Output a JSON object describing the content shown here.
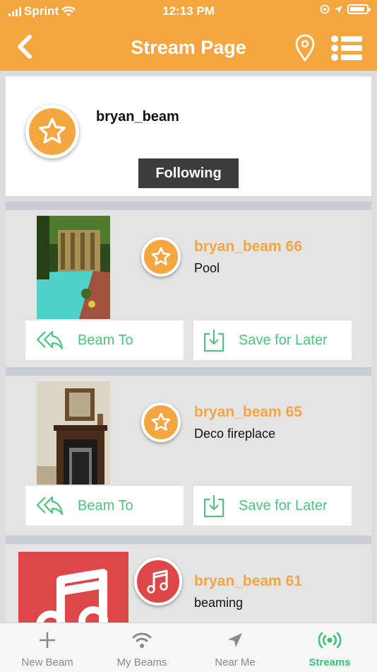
{
  "status_bar": {
    "carrier": "Sprint",
    "time": "12:13 PM"
  },
  "header": {
    "title": "Stream Page",
    "back_icon": "chevron-left-icon",
    "location_icon": "map-pin-icon",
    "menu_icon": "list-icon"
  },
  "profile": {
    "username": "bryan_beam",
    "follow_label": "Following",
    "avatar_icon": "star-icon"
  },
  "posts": [
    {
      "user": "bryan_beam 66",
      "caption": "Pool",
      "avatar_icon": "star-icon",
      "beam_to_label": "Beam To",
      "save_label": "Save for Later"
    },
    {
      "user": "bryan_beam 65",
      "caption": "Deco fireplace",
      "avatar_icon": "star-icon",
      "beam_to_label": "Beam To",
      "save_label": "Save for Later"
    },
    {
      "user": "bryan_beam 61",
      "caption": "beaming",
      "avatar_icon": "music-note-icon"
    }
  ],
  "tabs": [
    {
      "label": "New Beam",
      "icon": "plus-icon",
      "active": false
    },
    {
      "label": "My Beams",
      "icon": "wifi-icon",
      "active": false
    },
    {
      "label": "Near Me",
      "icon": "navigation-arrow-icon",
      "active": false
    },
    {
      "label": "Streams",
      "icon": "broadcast-icon",
      "active": true
    }
  ],
  "colors": {
    "brand": "#f4a640",
    "accent": "#4cc47f",
    "music": "#dd4747",
    "follow_button": "#3c3c3c"
  }
}
